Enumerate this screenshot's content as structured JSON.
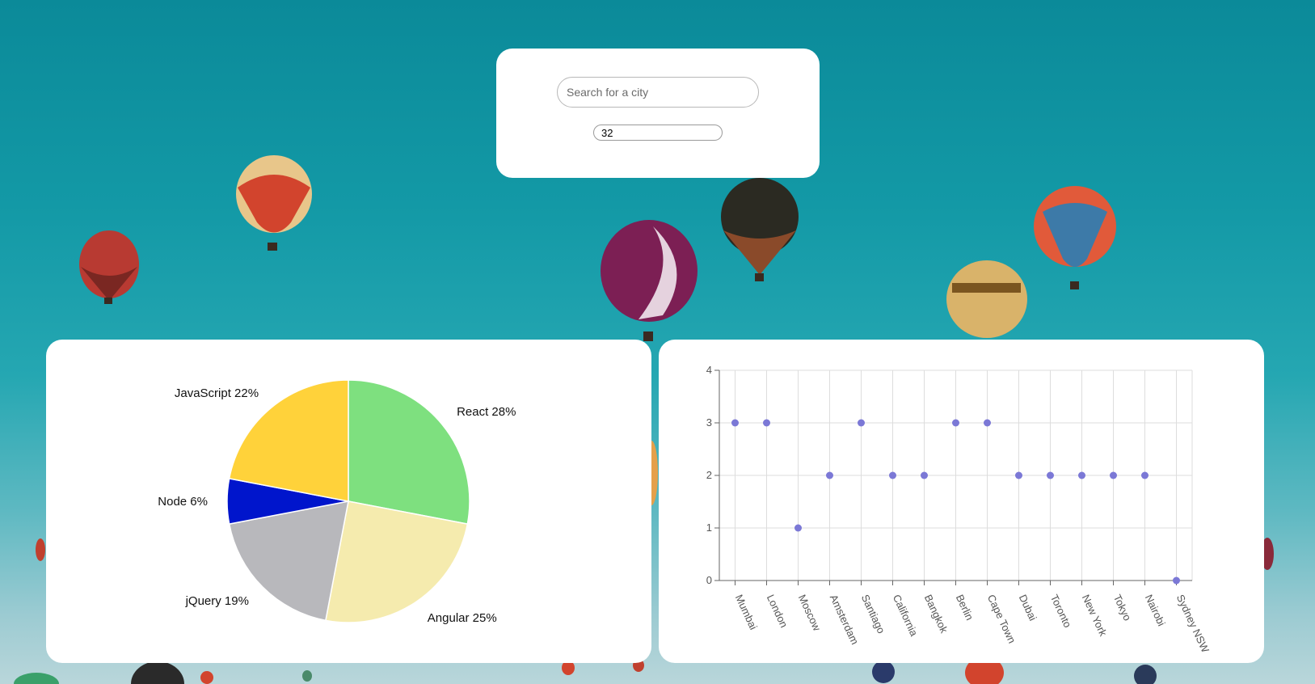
{
  "search": {
    "placeholder": "Search for a city",
    "value": "",
    "count_value": "32"
  },
  "colors": {
    "sky_top": "#0b8a99",
    "card_bg": "#ffffff",
    "scatter_point": "#7b78d6",
    "grid": "#dddddd"
  },
  "chart_data": [
    {
      "type": "pie",
      "title": "",
      "slices": [
        {
          "label": "React 28%",
          "value": 28,
          "color": "#7ee07f"
        },
        {
          "label": "Angular 25%",
          "value": 25,
          "color": "#f5ebae"
        },
        {
          "label": "jQuery 19%",
          "value": 19,
          "color": "#b8b8bc"
        },
        {
          "label": "Node 6%",
          "value": 6,
          "color": "#0015cc"
        },
        {
          "label": "JavaScript 22%",
          "value": 22,
          "color": "#ffd23a"
        }
      ]
    },
    {
      "type": "scatter",
      "title": "",
      "xlabel": "",
      "ylabel": "",
      "ylim": [
        0,
        4
      ],
      "yticks": [
        "0",
        "1",
        "2",
        "3",
        "4"
      ],
      "grid": true,
      "categories": [
        "Mumbai",
        "London",
        "Moscow",
        "Amsterdam",
        "Santiago",
        "California",
        "Bangkok",
        "Berlin",
        "Cape Town",
        "Dubai",
        "Toronto",
        "New York",
        "Tokyo",
        "Nairobi",
        "Sydney NSW"
      ],
      "values": [
        3,
        3,
        1,
        2,
        3,
        2,
        2,
        3,
        3,
        2,
        2,
        2,
        2,
        2,
        0
      ]
    }
  ]
}
